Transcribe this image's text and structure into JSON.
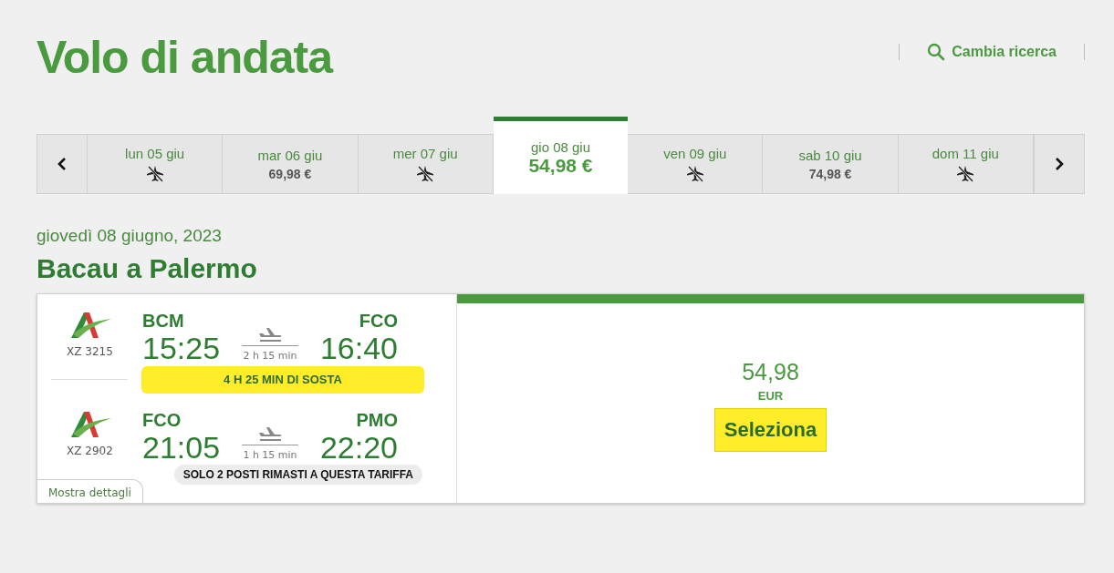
{
  "title": "Volo di andata",
  "change_search": "Cambia ricerca",
  "days": [
    {
      "label": "lun 05 giu",
      "kind": "none",
      "selected": false
    },
    {
      "label": "mar 06 giu",
      "kind": "price",
      "price": "69,98 €",
      "selected": false
    },
    {
      "label": "mer 07 giu",
      "kind": "none",
      "selected": false
    },
    {
      "label": "gio 08 giu",
      "kind": "price",
      "price": "54,98 €",
      "selected": true
    },
    {
      "label": "ven 09 giu",
      "kind": "none",
      "selected": false
    },
    {
      "label": "sab 10 giu",
      "kind": "price",
      "price": "74,98 €",
      "selected": false
    },
    {
      "label": "dom 11 giu",
      "kind": "none",
      "selected": false
    }
  ],
  "date": "giovedì 08 giugno, 2023",
  "route": "Bacau a Palermo",
  "segments": [
    {
      "flight": "XZ 3215",
      "from": "BCM",
      "dep": "15:25",
      "duration": "2 h 15 min",
      "to": "FCO",
      "arr": "16:40"
    },
    {
      "flight": "XZ 2902",
      "from": "FCO",
      "dep": "21:05",
      "duration": "1 h 15 min",
      "to": "PMO",
      "arr": "22:20"
    }
  ],
  "stopover": "4 H 25 MIN DI SOSTA",
  "seats_note": "SOLO 2 POSTI RIMASTI A QUESTA TARIFFA",
  "details_link": "Mostra dettagli",
  "fare": {
    "price": "54,98",
    "currency": "EUR",
    "button": "Seleziona"
  }
}
